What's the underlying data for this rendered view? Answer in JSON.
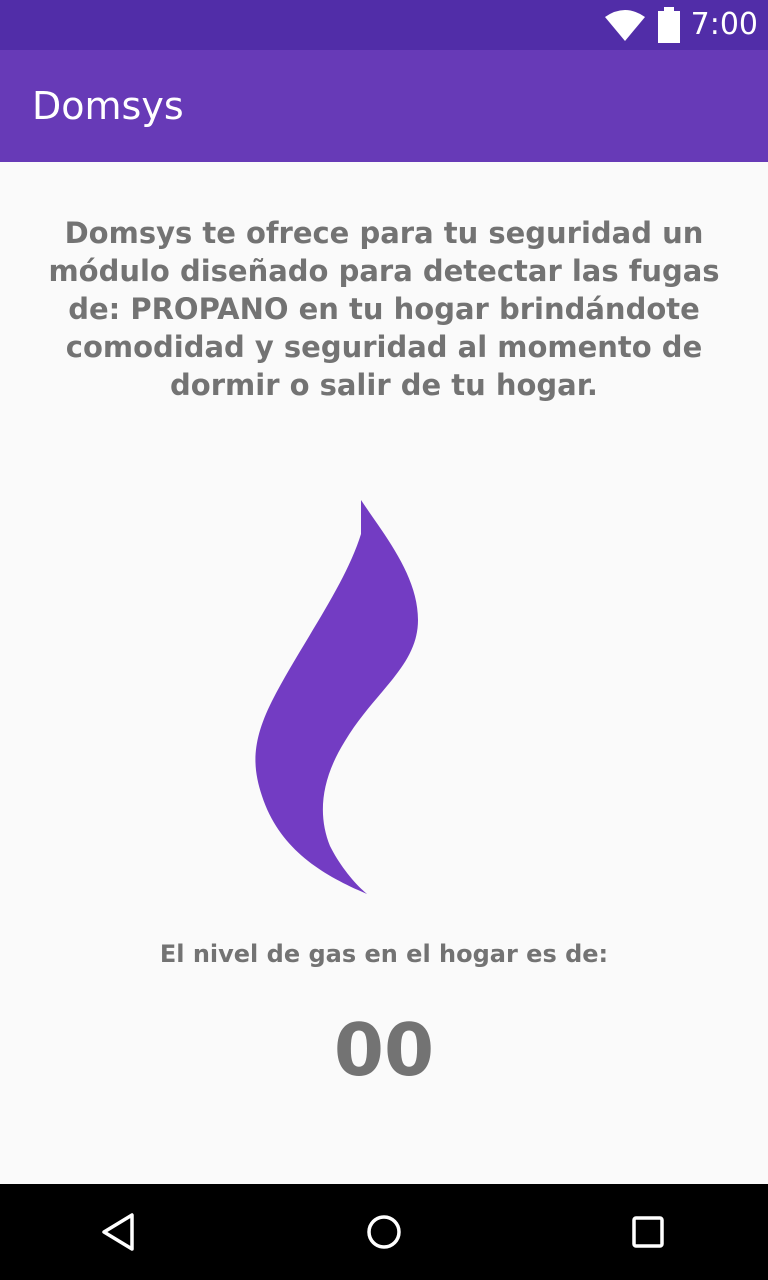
{
  "status_bar": {
    "time": "7:00",
    "icons": [
      "wifi-icon",
      "battery-icon"
    ]
  },
  "app_bar": {
    "title": "Domsys"
  },
  "main": {
    "description": "Domsys te ofrece para tu seguridad un módulo diseñado para detectar las fugas de: PROPANO en tu hogar brindándote comodidad y seguridad al momento de dormir o salir de tu hogar.",
    "flame_icon": "flame-icon",
    "gas_level_label": "El nivel de gas en el hogar es de:",
    "gas_level_value": "00"
  },
  "nav_bar": {
    "buttons": [
      "back-icon",
      "home-icon",
      "recents-icon"
    ]
  },
  "colors": {
    "status_bar": "#512DA8",
    "app_bar": "#673AB7",
    "flame": "#733CC3",
    "text": "#737373",
    "background": "#FAFAFA",
    "nav_bar": "#000000"
  }
}
